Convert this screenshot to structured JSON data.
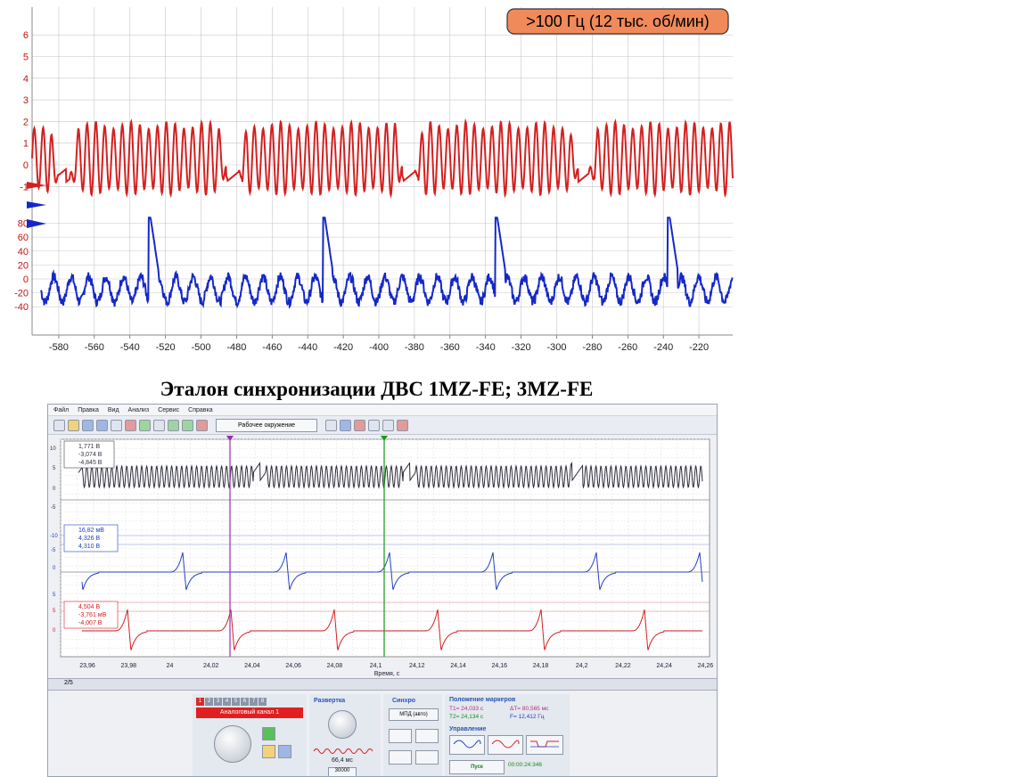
{
  "top_chart": {
    "badge": ">100 Гц (12 тыс. об/мин)",
    "colors": {
      "red": "#d42020",
      "blue": "#1428c8",
      "badge_bg": "#f08a5a",
      "grid": "#c8c8c8",
      "axis_labels": "#c21515",
      "blue_labels": "#2a3fb5"
    },
    "red_ticks": [
      "6",
      "5",
      "4",
      "3",
      "2",
      "1",
      "0",
      "-1"
    ],
    "blue_ticks": [
      "80",
      "60",
      "40",
      "20",
      "0",
      "-20",
      "-40"
    ],
    "x_ticks": [
      "-580",
      "-560",
      "-540",
      "-520",
      "-500",
      "-480",
      "-460",
      "-440",
      "-420",
      "-400",
      "-380",
      "-360",
      "-340",
      "-320",
      "-300",
      "-280",
      "-260",
      "-240",
      "-220"
    ]
  },
  "chart_data": [
    {
      "type": "line",
      "series": [
        {
          "unit": "V",
          "color": "#d42020",
          "waveform": "oscillation approx. -1.4..2 with flattened gaps near x = -577, -482, -383, -285",
          "y_range": [
            -1.5,
            2.2
          ]
        },
        {
          "unit": "V",
          "color": "#1428c8",
          "waveform": "noisy ripple approx. -40..10 with spikes to ~88 at x = -529, -431, -334, -237",
          "y_range": [
            -45,
            90
          ]
        }
      ],
      "x_range": [
        -595,
        -201
      ],
      "grid": true
    },
    {
      "type": "line",
      "series": [
        {
          "color": "#2d2d3a",
          "waveform": "dense oscillation"
        },
        {
          "color": "#2040c0",
          "waveform": "periodic pulses every ~0.058 s"
        },
        {
          "color": "#d42020",
          "waveform": "periodic pulses every ~0.058 s"
        }
      ],
      "x_ticks": [
        "23,96",
        "23,98",
        "24",
        "24,02",
        "24,04",
        "24,06",
        "24,08",
        "24,1",
        "24,12",
        "24,14",
        "24,16",
        "24,18",
        "24,2",
        "24,22",
        "24,24",
        "24,26"
      ],
      "xlabel": "Время, с",
      "grid": true
    }
  ],
  "title": "Эталон синхронизации ДВС 1MZ-FE; 3MZ-FE",
  "app": {
    "menu": [
      "Файл",
      "Правка",
      "Вид",
      "Анализ",
      "Сервис",
      "Справка"
    ],
    "environment_button": "Рабочее окружение",
    "channels": [
      {
        "readouts": [
          "1,771 В",
          "-3,074 В",
          "-4,845 В"
        ],
        "y_ticks": [
          "10",
          "5",
          "0",
          "-5"
        ],
        "color": "#2d2d3a"
      },
      {
        "readouts": [
          "16,82 мВ",
          "4,326 В",
          "4,310 В"
        ],
        "y_ticks": [
          "-10",
          "-5",
          "0",
          "5"
        ],
        "color": "#2040c0"
      },
      {
        "readouts": [
          "4,504 В",
          "-3,761 мВ",
          "-4,007 В"
        ],
        "y_ticks": [
          "5",
          "0"
        ],
        "color": "#d42020"
      }
    ],
    "page": "2/5",
    "channel_tabs": [
      "1",
      "2",
      "3",
      "4",
      "5",
      "6",
      "7",
      "8"
    ],
    "channel_name": "Аналоговый канал 1",
    "sweep_title": "Развертка",
    "sweep_value": "66,4 мс",
    "sweep_count": "30000",
    "sync_title": "Синхро",
    "sync_mode": "МПД (авто)",
    "markers_title": "Положение маркеров",
    "markers": {
      "t1": "T1= 24,033 с",
      "t2": "T2= 24,134 с",
      "dt": "ΔT= 80,565 мс",
      "f": "F= 12,412 Гц"
    },
    "control_title": "Управление",
    "start_label": "Пуск",
    "timer": "00:00:24:346"
  }
}
